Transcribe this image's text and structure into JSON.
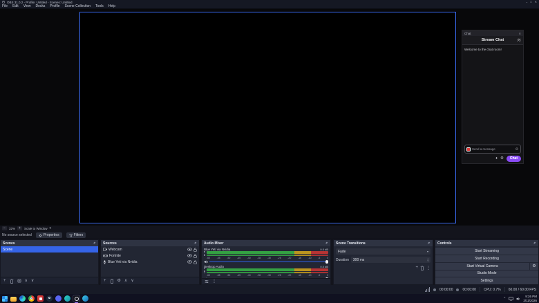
{
  "window": {
    "title": "OBS 31.0.2 - Profile: Untitled - Scenes: Untitled"
  },
  "menu": {
    "items": [
      "File",
      "Edit",
      "View",
      "Docks",
      "Profile",
      "Scene Collection",
      "Tools",
      "Help"
    ]
  },
  "chat": {
    "dock_title": "Chat",
    "header": "Stream Chat",
    "welcome": "Welcome to the chat room!",
    "input_placeholder": "Send a message",
    "send_button": "Chat"
  },
  "preview": {
    "zoom_out": "−",
    "zoom_level": "32%",
    "zoom_in": "+",
    "scale_mode": "Scale to Window",
    "no_source": "No source selected",
    "properties_button": "Properties",
    "filters_button": "Filters"
  },
  "scenes": {
    "title": "Scenes",
    "items": [
      "Scene"
    ]
  },
  "sources": {
    "title": "Sources",
    "items": [
      {
        "name": "Webcam",
        "icon": "camera-icon"
      },
      {
        "name": "Fortnite",
        "icon": "game-controller-icon"
      },
      {
        "name": "Blue Yeti via Nvidia",
        "icon": "microphone-icon"
      }
    ]
  },
  "mixer": {
    "title": "Audio Mixer",
    "channels": [
      {
        "name": "Blue Yeti via Nvidia",
        "level": "0.0 dB"
      },
      {
        "name": "Desktop Audio",
        "level": "0.0 dB"
      }
    ],
    "ticks": [
      "-60",
      "-55",
      "-50",
      "-45",
      "-40",
      "-35",
      "-30",
      "-25",
      "-20",
      "-15",
      "-10",
      "-5",
      "0"
    ],
    "colors": {
      "green": "#34a143",
      "yellow": "#bb941f",
      "red": "#b53434",
      "slider": "#3060e0"
    }
  },
  "transitions": {
    "title": "Scene Transitions",
    "transition": "Fade",
    "duration_label": "Duration",
    "duration_value": "300 ms"
  },
  "controls": {
    "title": "Controls",
    "buttons": [
      "Start Streaming",
      "Start Recording",
      "Start Virtual Camera",
      "Studio Mode",
      "Settings"
    ]
  },
  "statusbar": {
    "stream_time": "00:00:00",
    "rec_time": "00:00:00",
    "cpu": "CPU: 0.7%",
    "fps": "60.00 / 60.00 FPS"
  },
  "taskbar": {
    "time": "9:26 PM",
    "date": "2/11/2026"
  },
  "colors": {
    "selection_blue": "#3564e8",
    "preview_border": "#3b6cf5",
    "chat_accent_purple": "#8a4bf5",
    "panel_bg": "#222633",
    "titlebar_bg": "#151823"
  }
}
